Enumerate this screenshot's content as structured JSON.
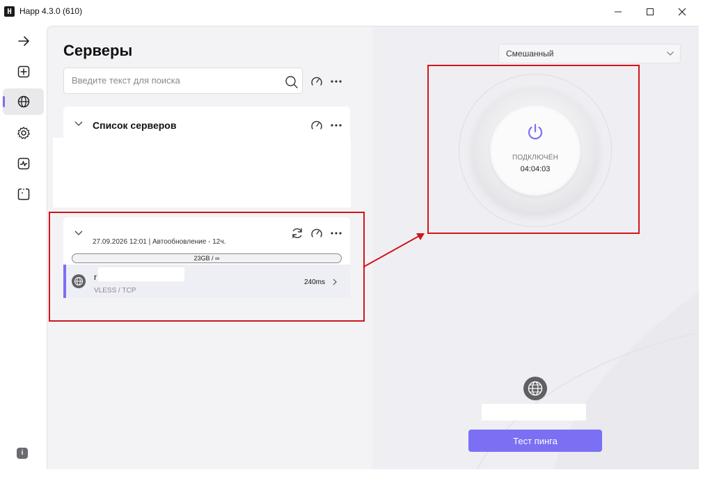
{
  "window": {
    "title": "Happ 4.3.0 (610)",
    "logo_text": "H"
  },
  "sidebar": {
    "items": [
      {
        "icon": "arrow-right-icon"
      },
      {
        "icon": "add-square-icon"
      },
      {
        "icon": "globe-icon",
        "active": true
      },
      {
        "icon": "gear-icon"
      },
      {
        "icon": "activity-chart-icon"
      },
      {
        "icon": "scan-icon"
      }
    ],
    "info_label": "i"
  },
  "servers": {
    "title": "Серверы",
    "search": {
      "placeholder": "Введите текст для поиска"
    },
    "group": {
      "title": "Список серверов"
    },
    "subscription": {
      "updated": "27.09.2026 12:01 | Автообновление - 12ч.",
      "traffic": "23GB / ∞"
    },
    "server": {
      "name": "r",
      "protocol": "VLESS / TCP",
      "ping": "240ms"
    }
  },
  "connection": {
    "mode": "Смешанный",
    "status": "ПОДКЛЮЧЁН",
    "timer": "04:04:03",
    "ping_button": "Тест пинга"
  },
  "colors": {
    "accent": "#7b70f3",
    "annotation_red": "#d2141a"
  }
}
